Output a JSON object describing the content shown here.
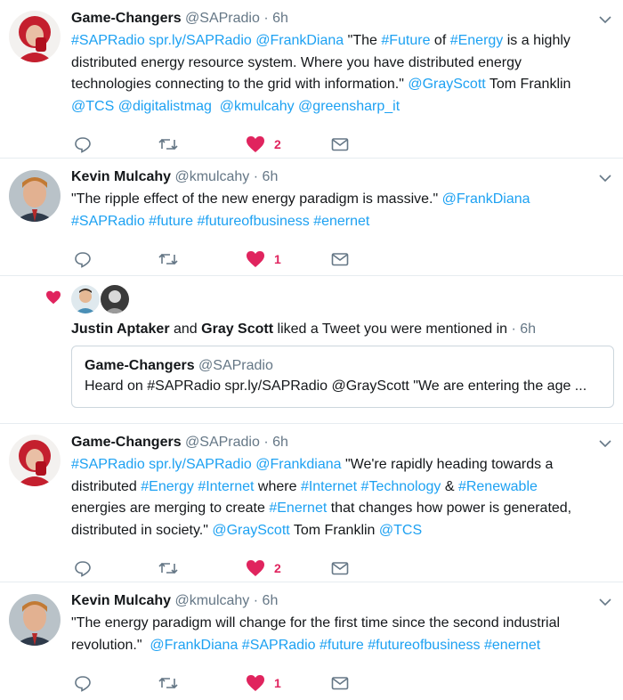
{
  "tweets": [
    {
      "name": "Game-Changers",
      "handle": "@SAPradio",
      "dot": "·",
      "time": "6h",
      "lines": [
        [
          {
            "t": "#SAPRadio",
            "link": true
          },
          {
            "t": " ",
            "link": false
          },
          {
            "t": "spr.ly/SAPRadio",
            "link": true
          },
          {
            "t": " ",
            "link": false
          },
          {
            "t": "@FrankDiana",
            "link": true
          },
          {
            "t": " \"The ",
            "link": false
          },
          {
            "t": "#Future",
            "link": true
          },
          {
            "t": " of ",
            "link": false
          },
          {
            "t": "#Energy",
            "link": true
          },
          {
            "t": " is a highly",
            "link": false
          }
        ],
        [
          {
            "t": "distributed energy resource system. Where you have distributed energy",
            "link": false
          }
        ],
        [
          {
            "t": "technologies connecting to the grid with information.\" ",
            "link": false
          },
          {
            "t": "@GrayScott",
            "link": true
          },
          {
            "t": " Tom Franklin",
            "link": false
          }
        ],
        [
          {
            "t": "@TCS",
            "link": true
          },
          {
            "t": " ",
            "link": false
          },
          {
            "t": "@digitalistmag",
            "link": true
          },
          {
            "t": "  ",
            "link": false
          },
          {
            "t": "@kmulcahy",
            "link": true
          },
          {
            "t": " ",
            "link": false
          },
          {
            "t": "@greensharp_it",
            "link": true
          }
        ]
      ],
      "likes": "2"
    },
    {
      "name": "Kevin Mulcahy",
      "handle": "@kmulcahy",
      "dot": "·",
      "time": "6h",
      "lines": [
        [
          {
            "t": "\"The ripple effect of the new energy paradigm is massive.\" ",
            "link": false
          },
          {
            "t": "@FrankDiana",
            "link": true
          }
        ],
        [
          {
            "t": "#SAPRadio",
            "link": true
          },
          {
            "t": " ",
            "link": false
          },
          {
            "t": "#future",
            "link": true
          },
          {
            "t": " ",
            "link": false
          },
          {
            "t": "#futureofbusiness",
            "link": true
          },
          {
            "t": " ",
            "link": false
          },
          {
            "t": "#enernet",
            "link": true
          }
        ]
      ],
      "likes": "1"
    },
    {
      "name": "Game-Changers",
      "handle": "@SAPradio",
      "dot": "·",
      "time": "6h",
      "lines": [
        [
          {
            "t": "#SAPRadio",
            "link": true
          },
          {
            "t": " ",
            "link": false
          },
          {
            "t": "spr.ly/SAPRadio",
            "link": true
          },
          {
            "t": " ",
            "link": false
          },
          {
            "t": "@Frankdiana",
            "link": true
          },
          {
            "t": " \"We're rapidly heading towards a",
            "link": false
          }
        ],
        [
          {
            "t": "distributed ",
            "link": false
          },
          {
            "t": "#Energy",
            "link": true
          },
          {
            "t": " ",
            "link": false
          },
          {
            "t": "#Internet",
            "link": true
          },
          {
            "t": " where ",
            "link": false
          },
          {
            "t": "#Internet",
            "link": true
          },
          {
            "t": " ",
            "link": false
          },
          {
            "t": "#Technology",
            "link": true
          },
          {
            "t": " & ",
            "link": false
          },
          {
            "t": "#Renewable",
            "link": true
          }
        ],
        [
          {
            "t": "energies are merging to create ",
            "link": false
          },
          {
            "t": "#Enernet",
            "link": true
          },
          {
            "t": " that changes how power is generated,",
            "link": false
          }
        ],
        [
          {
            "t": "distributed in society.\" ",
            "link": false
          },
          {
            "t": "@GrayScott",
            "link": true
          },
          {
            "t": " Tom Franklin ",
            "link": false
          },
          {
            "t": "@TCS",
            "link": true
          }
        ]
      ],
      "likes": "2"
    },
    {
      "name": "Kevin Mulcahy",
      "handle": "@kmulcahy",
      "dot": "·",
      "time": "6h",
      "lines": [
        [
          {
            "t": "\"The energy paradigm will change for the first time since the second industrial",
            "link": false
          }
        ],
        [
          {
            "t": "revolution.\"  ",
            "link": false
          },
          {
            "t": "@FrankDiana",
            "link": true
          },
          {
            "t": " ",
            "link": false
          },
          {
            "t": "#SAPRadio",
            "link": true
          },
          {
            "t": " ",
            "link": false
          },
          {
            "t": "#future",
            "link": true
          },
          {
            "t": " ",
            "link": false
          },
          {
            "t": "#futureofbusiness",
            "link": true
          },
          {
            "t": " ",
            "link": false
          },
          {
            "t": "#enernet",
            "link": true
          }
        ]
      ],
      "likes": "1"
    }
  ],
  "notification": {
    "user1": "Justin Aptaker",
    "and": " and ",
    "user2": "Gray Scott",
    "action": " liked a Tweet you were mentioned in",
    "dot": " · ",
    "time": "6h",
    "quote": {
      "name": "Game-Changers",
      "handle": "@SAPradio",
      "text": "Heard on #SAPRadio spr.ly/SAPRadio @GrayScott \"We are entering the age ..."
    }
  },
  "colors": {
    "link": "#1da1f2",
    "like": "#e0245e",
    "icon": "#657786",
    "divider": "#e6ecf0"
  }
}
